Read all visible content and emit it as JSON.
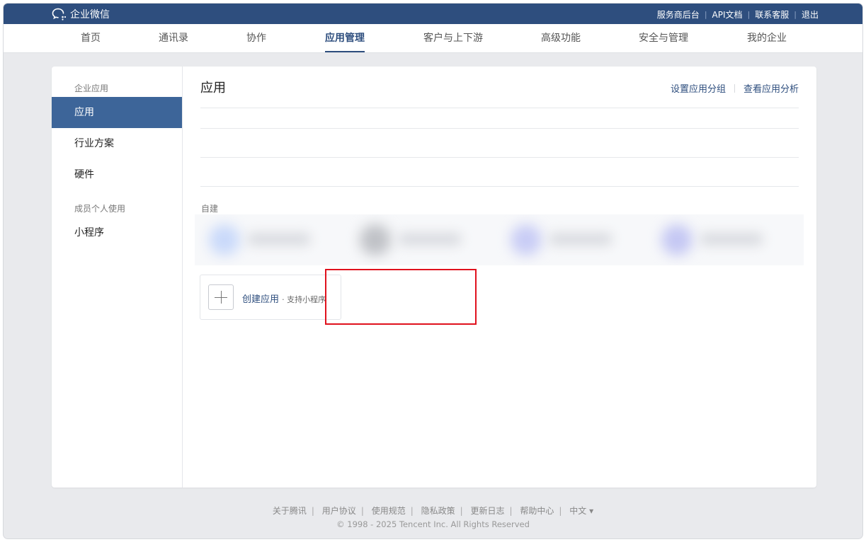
{
  "brand": {
    "name": "企业微信",
    "icon": "wecom-logo-icon"
  },
  "top_links": [
    {
      "label": "服务商后台"
    },
    {
      "label": "API文档"
    },
    {
      "label": "联系客服"
    },
    {
      "label": "退出"
    }
  ],
  "nav": {
    "tabs": [
      {
        "label": "首页"
      },
      {
        "label": "通讯录"
      },
      {
        "label": "协作"
      },
      {
        "label": "应用管理",
        "active": true
      },
      {
        "label": "客户与上下游"
      },
      {
        "label": "高级功能"
      },
      {
        "label": "安全与管理"
      },
      {
        "label": "我的企业"
      }
    ]
  },
  "sidebar": {
    "group1_label": "企业应用",
    "items": [
      {
        "label": "应用",
        "active": true
      },
      {
        "label": "行业方案"
      },
      {
        "label": "硬件"
      }
    ],
    "group2_label": "成员个人使用",
    "items2": [
      {
        "label": "小程序"
      }
    ]
  },
  "main": {
    "title": "应用",
    "actions": [
      {
        "label": "设置应用分组"
      },
      {
        "label": "查看应用分析"
      }
    ],
    "section_label": "自建",
    "create": {
      "label": "创建应用",
      "sub": "· 支持小程序",
      "icon": "plus-icon"
    }
  },
  "footer": {
    "links": [
      "关于腾讯",
      "用户协议",
      "使用规范",
      "隐私政策",
      "更新日志",
      "帮助中心"
    ],
    "language": "中文 ▾",
    "copyright": "© 1998 - 2025 Tencent Inc. All Rights Reserved"
  },
  "colors": {
    "brand_blue": "#2e4e7e",
    "sidebar_active": "#3d6599",
    "highlight_red": "#e0111d"
  }
}
